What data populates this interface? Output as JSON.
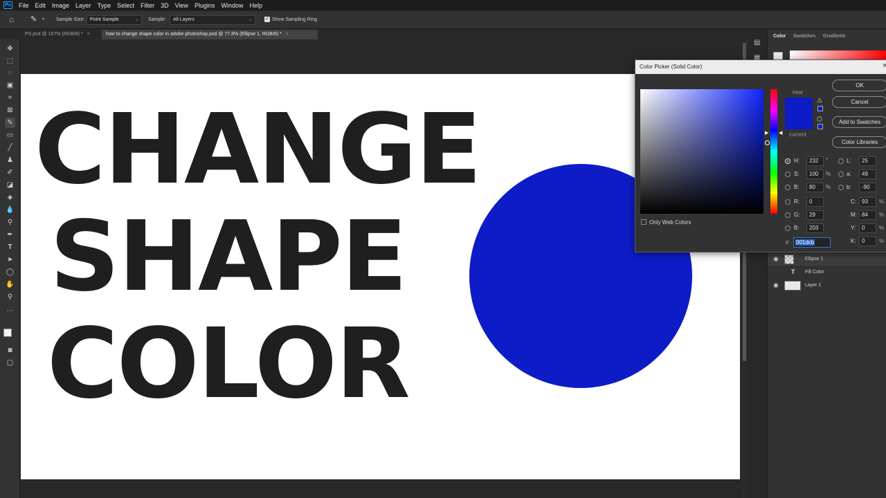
{
  "app": {
    "logo": "Ps"
  },
  "menu": [
    "File",
    "Edit",
    "Image",
    "Layer",
    "Type",
    "Select",
    "Filter",
    "3D",
    "View",
    "Plugins",
    "Window",
    "Help"
  ],
  "options": {
    "sample_size_label": "Sample Size:",
    "sample_size_value": "Point Sample",
    "sample_label": "Sample:",
    "sample_value": "All Layers",
    "show_ring_label": "Show Sampling Ring"
  },
  "tabs": [
    {
      "label": "PS.psd @ 167% (RGB/8) *",
      "close": "×"
    },
    {
      "label": "how to change shape color in adobe photoshop.psd @ 77.8% (Ellipse 1, RGB/8) *",
      "close": "×"
    }
  ],
  "canvas": {
    "line1": "CHANGE",
    "line2": "SHAPE",
    "line3": "COLOR",
    "shape_color": "#0d1cc6"
  },
  "panel": {
    "tabs": [
      "Color",
      "Swatches",
      "Gradients"
    ],
    "layers": [
      {
        "name": "Ellipse 1"
      },
      {
        "name": "Fill Color"
      },
      {
        "name": "Layer 1"
      }
    ]
  },
  "dialog": {
    "title": "Color Picker (Solid Color)",
    "close": "×",
    "new_label": "new",
    "current_label": "current",
    "buttons": {
      "ok": "OK",
      "cancel": "Cancel",
      "add": "Add to Swatches",
      "libraries": "Color Libraries"
    },
    "hsb": {
      "h": "232",
      "s": "100",
      "b": "80"
    },
    "rgb": {
      "r": "0",
      "g": "29",
      "b": "203"
    },
    "lab": {
      "l": "25",
      "a": "49",
      "b": "-90"
    },
    "cmyk": {
      "c": "93",
      "m": "84",
      "y": "0",
      "k": "0"
    },
    "hex_label": "#",
    "hex": "001dcb",
    "only_web": "Only Web Colors",
    "units": {
      "deg": "°",
      "pct": "%"
    },
    "labels": {
      "h": "H:",
      "s": "S:",
      "bb": "B:",
      "r": "R:",
      "g": "G:",
      "rb": "B:",
      "l": "L:",
      "a": "a:",
      "lb": "b:",
      "c": "C:",
      "m": "M:",
      "y": "Y:",
      "k": "K:"
    }
  }
}
